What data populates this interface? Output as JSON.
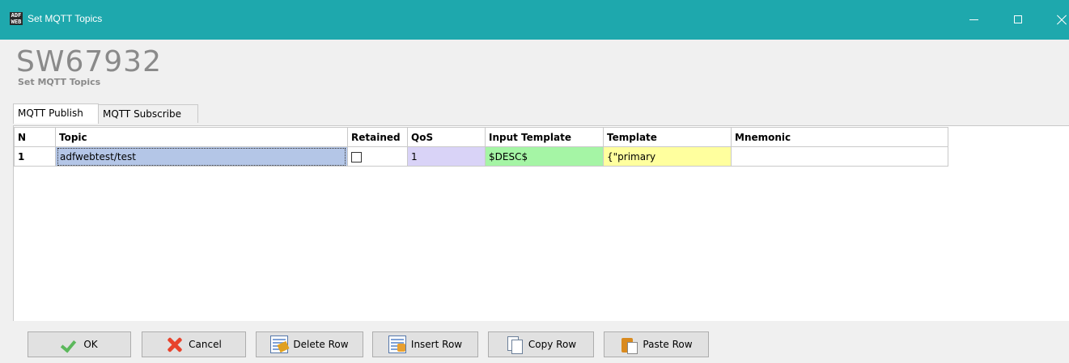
{
  "window": {
    "icon_text": [
      "ADF",
      "WEB"
    ],
    "title": "Set MQTT Topics"
  },
  "header": {
    "product_code": "SW67932",
    "subtitle": "Set MQTT Topics"
  },
  "tabs": [
    {
      "label": "MQTT Publish",
      "active": true
    },
    {
      "label": "MQTT Subscribe",
      "active": false
    }
  ],
  "grid": {
    "columns": [
      "N",
      "Topic",
      "Retained",
      "QoS",
      "Input Template",
      "Template",
      "Mnemonic"
    ],
    "rows": [
      {
        "n": "1",
        "topic": "adfwebtest/test",
        "retained": false,
        "qos": "1",
        "input_template": "$DESC$",
        "template": "{\"primary",
        "mnemonic": ""
      }
    ],
    "colors": {
      "topic_selected": "#b4c6e7",
      "qos": "#d9d3f7",
      "input_template": "#a5f5a5",
      "template": "#ffff9e"
    }
  },
  "buttons": {
    "ok": {
      "label": "OK",
      "icon": "check-icon"
    },
    "cancel": {
      "label": "Cancel",
      "icon": "x-icon"
    },
    "delete_row": {
      "label": "Delete Row",
      "icon": "delete-row-icon"
    },
    "insert_row": {
      "label": "Insert Row",
      "icon": "insert-row-icon"
    },
    "copy_row": {
      "label": "Copy Row",
      "icon": "copy-icon"
    },
    "paste_row": {
      "label": "Paste Row",
      "icon": "paste-icon"
    }
  },
  "theme": {
    "titlebar": "#1ea8ad",
    "window_bg": "#f0f0f0"
  }
}
